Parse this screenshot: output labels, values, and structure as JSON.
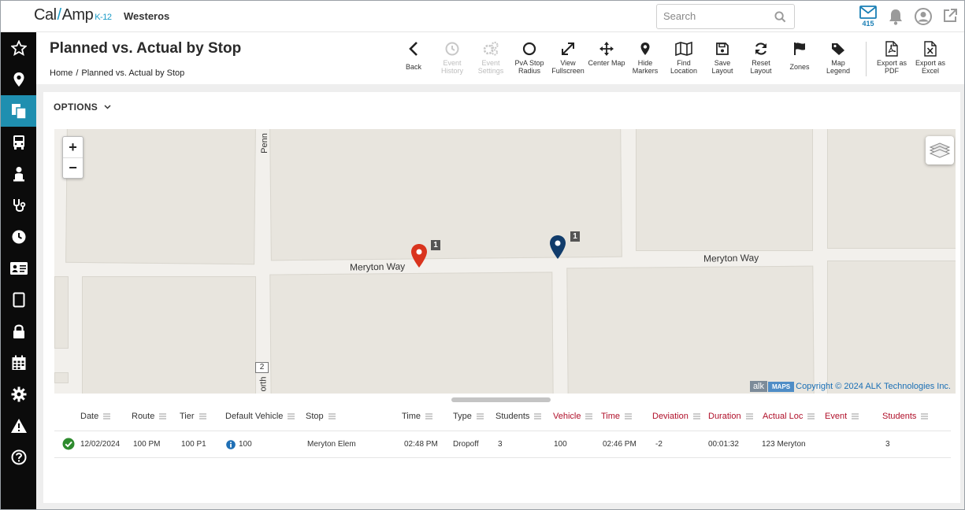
{
  "app": {
    "logo_main": "Cal",
    "logo_slash": "/",
    "logo_amp": "Amp",
    "logo_k12": "K-12",
    "org_name": "Westeros"
  },
  "search": {
    "placeholder": "Search"
  },
  "notifications": {
    "mail_count": "415"
  },
  "sidebar": {
    "items": [
      {
        "name": "favorites-icon",
        "active": false
      },
      {
        "name": "map-pin-icon",
        "active": false
      },
      {
        "name": "reports-icon",
        "active": true
      },
      {
        "name": "bus-icon",
        "active": false
      },
      {
        "name": "student-icon",
        "active": false
      },
      {
        "name": "stethoscope-icon",
        "active": false
      },
      {
        "name": "clock-icon",
        "active": false
      },
      {
        "name": "id-card-icon",
        "active": false
      },
      {
        "name": "tablet-icon",
        "active": false
      },
      {
        "name": "lock-icon",
        "active": false
      },
      {
        "name": "calendar-icon",
        "active": false
      },
      {
        "name": "gear-icon",
        "active": false
      },
      {
        "name": "warning-icon",
        "active": false
      },
      {
        "name": "help-icon",
        "active": false
      }
    ]
  },
  "page": {
    "title": "Planned vs. Actual by Stop",
    "breadcrumb": [
      "Home",
      "Planned vs. Actual by Stop"
    ],
    "breadcrumb_sep": "/"
  },
  "toolbar": {
    "back": "Back",
    "event_history": "Event History",
    "event_settings": "Event Settings",
    "pva_radius": "PvA Stop Radius",
    "view_fullscreen": "View Fullscreen",
    "center_map": "Center Map",
    "hide_markers": "Hide Markers",
    "find_location": "Find Location",
    "save_layout": "Save Layout",
    "reset_layout": "Reset Layout",
    "zones": "Zones",
    "map_legend": "Map Legend",
    "export_pdf": "Export as PDF",
    "export_excel": "Export as Excel"
  },
  "options": {
    "label": "OPTIONS"
  },
  "map": {
    "zoom_in": "+",
    "zoom_out": "−",
    "road_left": "Meryton Way",
    "road_right": "Meryton Way",
    "road_vertical_top": "Penn",
    "road_vertical_bottom": "orth",
    "route_shield": "2",
    "marker_red_count": "1",
    "marker_blue_count": "1",
    "alk": "alk",
    "maps": "MAPS",
    "copyright": "Copyright © 2024 ALK Technologies Inc.",
    "colors": {
      "planned_marker": "#d9341e",
      "actual_marker": "#113c6b"
    }
  },
  "table": {
    "headers": [
      {
        "label": "Date",
        "red": false
      },
      {
        "label": "Route",
        "red": false
      },
      {
        "label": "Tier",
        "red": false
      },
      {
        "label": "Default Vehicle",
        "red": false
      },
      {
        "label": "Stop",
        "red": false
      },
      {
        "label": "Time",
        "red": false
      },
      {
        "label": "Type",
        "red": false
      },
      {
        "label": "Students",
        "red": false
      },
      {
        "label": "Vehicle",
        "red": true
      },
      {
        "label": "Time",
        "red": true
      },
      {
        "label": "Deviation",
        "red": true
      },
      {
        "label": "Duration",
        "red": true
      },
      {
        "label": "Actual Loc",
        "red": true
      },
      {
        "label": "Event",
        "red": true
      },
      {
        "label": "Students",
        "red": true
      }
    ],
    "rows": [
      {
        "status": "check",
        "date": "12/02/2024",
        "route": "100 PM",
        "tier": "100 P1",
        "default_vehicle": "100",
        "stop": "Meryton Elem",
        "time": "02:48 PM",
        "type": "Dropoff",
        "students": "3",
        "vehicle": "100",
        "actual_time": "02:46 PM",
        "deviation": "-2",
        "duration": "00:01:32",
        "actual_loc": "123 Meryton",
        "event": "",
        "actual_students": "3"
      }
    ]
  }
}
